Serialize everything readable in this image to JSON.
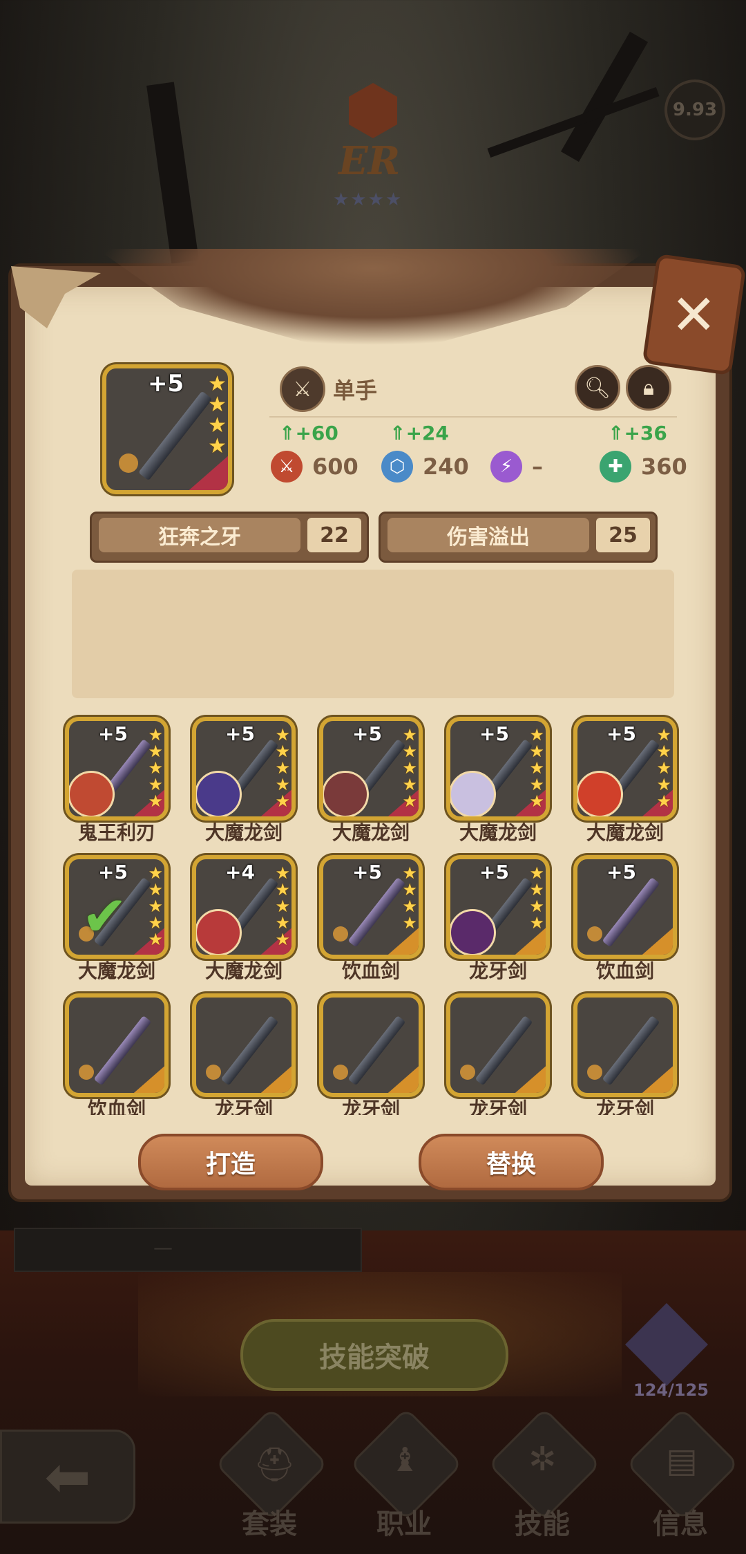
{
  "top": {
    "score": "9.93",
    "rank_text": "ER",
    "rank_stars": "★★★★"
  },
  "selected": {
    "enhance": "+5",
    "weapon_type": "单手",
    "stats": [
      {
        "inc": "+60",
        "value": "600",
        "icon": "attack-icon",
        "color": "#c04a30"
      },
      {
        "inc": "+24",
        "value": "240",
        "icon": "defense-icon",
        "color": "#4a8ac8"
      },
      {
        "inc": "",
        "value": "–",
        "icon": "magic-icon",
        "color": "#9a5ad0"
      },
      {
        "inc": "+36",
        "value": "360",
        "icon": "hp-icon",
        "color": "#3aa470"
      }
    ],
    "skills": [
      {
        "name": "狂奔之牙",
        "level": "22"
      },
      {
        "name": "伤害溢出",
        "level": "25"
      }
    ]
  },
  "grid": [
    {
      "plus": "+5",
      "name": "鬼王利刃",
      "stars": 5,
      "avatar": "#c04a32",
      "weapon": "purple",
      "corner": "red"
    },
    {
      "plus": "+5",
      "name": "大魔龙剑",
      "stars": 5,
      "avatar": "#4a3a8a",
      "weapon": "dark",
      "corner": "red"
    },
    {
      "plus": "+5",
      "name": "大魔龙剑",
      "stars": 5,
      "avatar": "#7a3a3a",
      "weapon": "dark",
      "corner": "red"
    },
    {
      "plus": "+5",
      "name": "大魔龙剑",
      "stars": 5,
      "avatar": "#c9c0e0",
      "weapon": "dark",
      "corner": "red"
    },
    {
      "plus": "+5",
      "name": "大魔龙剑",
      "stars": 5,
      "avatar": "#d0402a",
      "weapon": "dark",
      "corner": "red"
    },
    {
      "plus": "+5",
      "name": "大魔龙剑",
      "stars": 5,
      "avatar": "",
      "weapon": "dark",
      "corner": "red",
      "check": true
    },
    {
      "plus": "+4",
      "name": "大魔龙剑",
      "stars": 5,
      "avatar": "#b83a3a",
      "weapon": "dark",
      "corner": "red"
    },
    {
      "plus": "+5",
      "name": "饮血剑",
      "stars": 4,
      "avatar": "",
      "weapon": "purple",
      "corner": "orange"
    },
    {
      "plus": "+5",
      "name": "龙牙剑",
      "stars": 4,
      "avatar": "#5a2a6a",
      "weapon": "dark",
      "corner": "orange"
    },
    {
      "plus": "+5",
      "name": "饮血剑",
      "stars": 0,
      "avatar": "",
      "weapon": "purple",
      "corner": "orange"
    },
    {
      "plus": "",
      "name": "饮血剑",
      "stars": 0,
      "avatar": "",
      "weapon": "purple",
      "corner": "orange"
    },
    {
      "plus": "",
      "name": "龙牙剑",
      "stars": 0,
      "avatar": "",
      "weapon": "dark",
      "corner": "orange"
    },
    {
      "plus": "",
      "name": "龙牙剑",
      "stars": 0,
      "avatar": "",
      "weapon": "dark",
      "corner": "orange"
    },
    {
      "plus": "",
      "name": "龙牙剑",
      "stars": 0,
      "avatar": "",
      "weapon": "dark",
      "corner": "orange"
    },
    {
      "plus": "",
      "name": "龙牙剑",
      "stars": 0,
      "avatar": "",
      "weapon": "dark",
      "corner": "orange"
    }
  ],
  "actions": {
    "forge": "打造",
    "replace": "替换"
  },
  "lower": {
    "dim_bar_text": "—",
    "break_label": "技能突破",
    "monster_count": "124/125"
  },
  "nav": [
    {
      "label": "套装",
      "icon": "armor-set-icon",
      "glyph": "⛑"
    },
    {
      "label": "职业",
      "icon": "class-icon",
      "glyph": "♝"
    },
    {
      "label": "技能",
      "icon": "skill-icon",
      "glyph": "✲"
    },
    {
      "label": "信息",
      "icon": "info-icon",
      "glyph": "▤"
    }
  ]
}
